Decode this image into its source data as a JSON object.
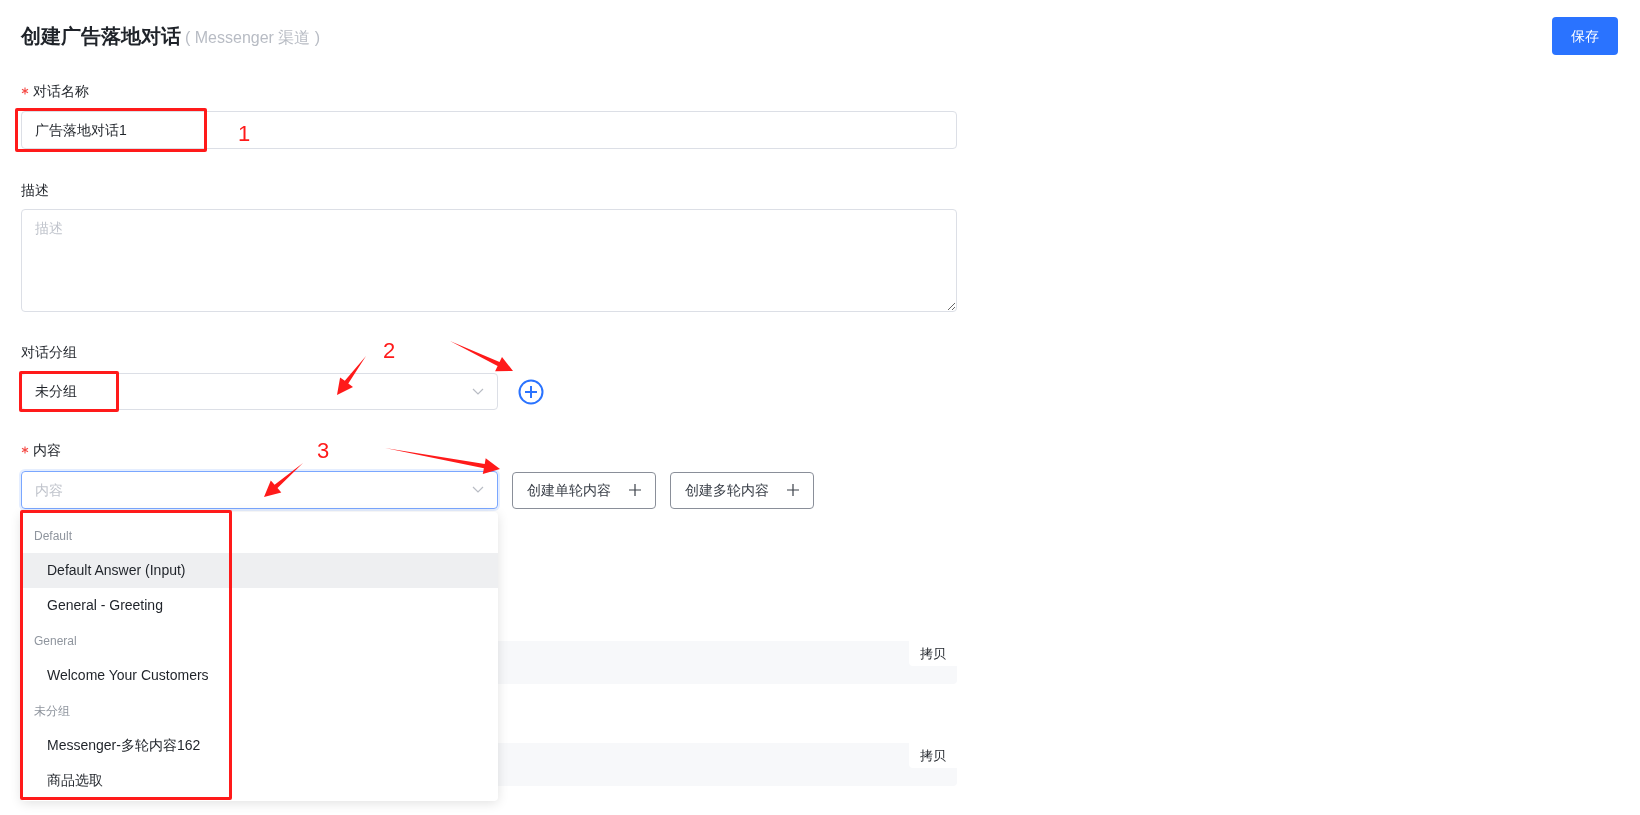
{
  "title": "创建广告落地对话",
  "subtitle": "( Messenger 渠道 )",
  "save_button": "保存",
  "name_field": {
    "label": "对话名称",
    "required": true,
    "value": "广告落地对话1"
  },
  "description_field": {
    "label": "描述",
    "required": false,
    "placeholder": "描述"
  },
  "group_field": {
    "label": "对话分组",
    "required": false,
    "value": "未分组"
  },
  "content_field": {
    "label": "内容",
    "required": true,
    "placeholder": "内容",
    "focused": true,
    "buttons": [
      "创建单轮内容",
      "创建多轮内容"
    ]
  },
  "dropdown": {
    "groups": [
      {
        "title": "Default",
        "options": [
          {
            "label": "Default Answer (Input)",
            "highlighted": true
          },
          {
            "label": "General - Greeting",
            "highlighted": false
          }
        ]
      },
      {
        "title": "General",
        "options": [
          {
            "label": "Welcome Your Customers",
            "highlighted": false
          }
        ]
      },
      {
        "title": "未分组",
        "options": [
          {
            "label": "Messenger-多轮内容162",
            "highlighted": false
          },
          {
            "label": "商品选取",
            "highlighted": false
          }
        ]
      }
    ]
  },
  "snippet_rows": [
    {
      "copy_button": "拷贝"
    },
    {
      "copy_button": "拷贝"
    }
  ],
  "annotation_numbers": [
    "1",
    "2",
    "3"
  ]
}
